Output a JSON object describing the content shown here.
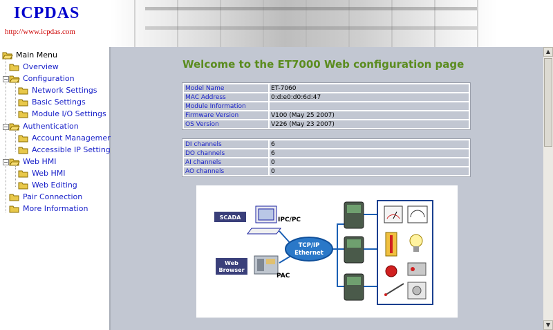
{
  "header": {
    "brand": "ICPDAS",
    "url": "http://www.icpdas.com"
  },
  "sidebar": {
    "items": [
      {
        "label": "Main Menu"
      },
      {
        "label": "Overview"
      },
      {
        "label": "Configuration"
      },
      {
        "label": "Network Settings"
      },
      {
        "label": "Basic Settings"
      },
      {
        "label": "Module I/O Settings"
      },
      {
        "label": "Authentication"
      },
      {
        "label": "Account Management"
      },
      {
        "label": "Accessible IP Settings"
      },
      {
        "label": "Web HMI"
      },
      {
        "label": "Web HMI"
      },
      {
        "label": "Web Editing"
      },
      {
        "label": "Pair Connection"
      },
      {
        "label": "More Information"
      }
    ]
  },
  "main": {
    "title": "Welcome to the ET7000 Web configuration page",
    "info_table": [
      {
        "key": "Model Name",
        "value": "ET-7060"
      },
      {
        "key": "MAC Address",
        "value": "0:d:e0:d0:6d:47"
      },
      {
        "key": "Module Information",
        "value": ""
      },
      {
        "key": "Firmware Version",
        "value": "V100 (May 25 2007)"
      },
      {
        "key": "OS Version",
        "value": "V226 (May 23 2007)"
      }
    ],
    "channel_table": [
      {
        "key": "DI channels",
        "value": "6"
      },
      {
        "key": "DO channels",
        "value": "6"
      },
      {
        "key": "AI channels",
        "value": "0"
      },
      {
        "key": "AO channels",
        "value": "0"
      }
    ],
    "diagram": {
      "scada": "SCADA",
      "ipc": "IPC/PC",
      "web": "Web",
      "browser": "Browser",
      "pac": "PAC",
      "hub_line1": "TCP/IP",
      "hub_line2": "Ethernet"
    }
  },
  "colors": {
    "title": "#5b8c1f",
    "link": "#1a22c9",
    "brand": "#0000cc",
    "url": "#cc0000",
    "main_bg": "#c2c7d2"
  }
}
